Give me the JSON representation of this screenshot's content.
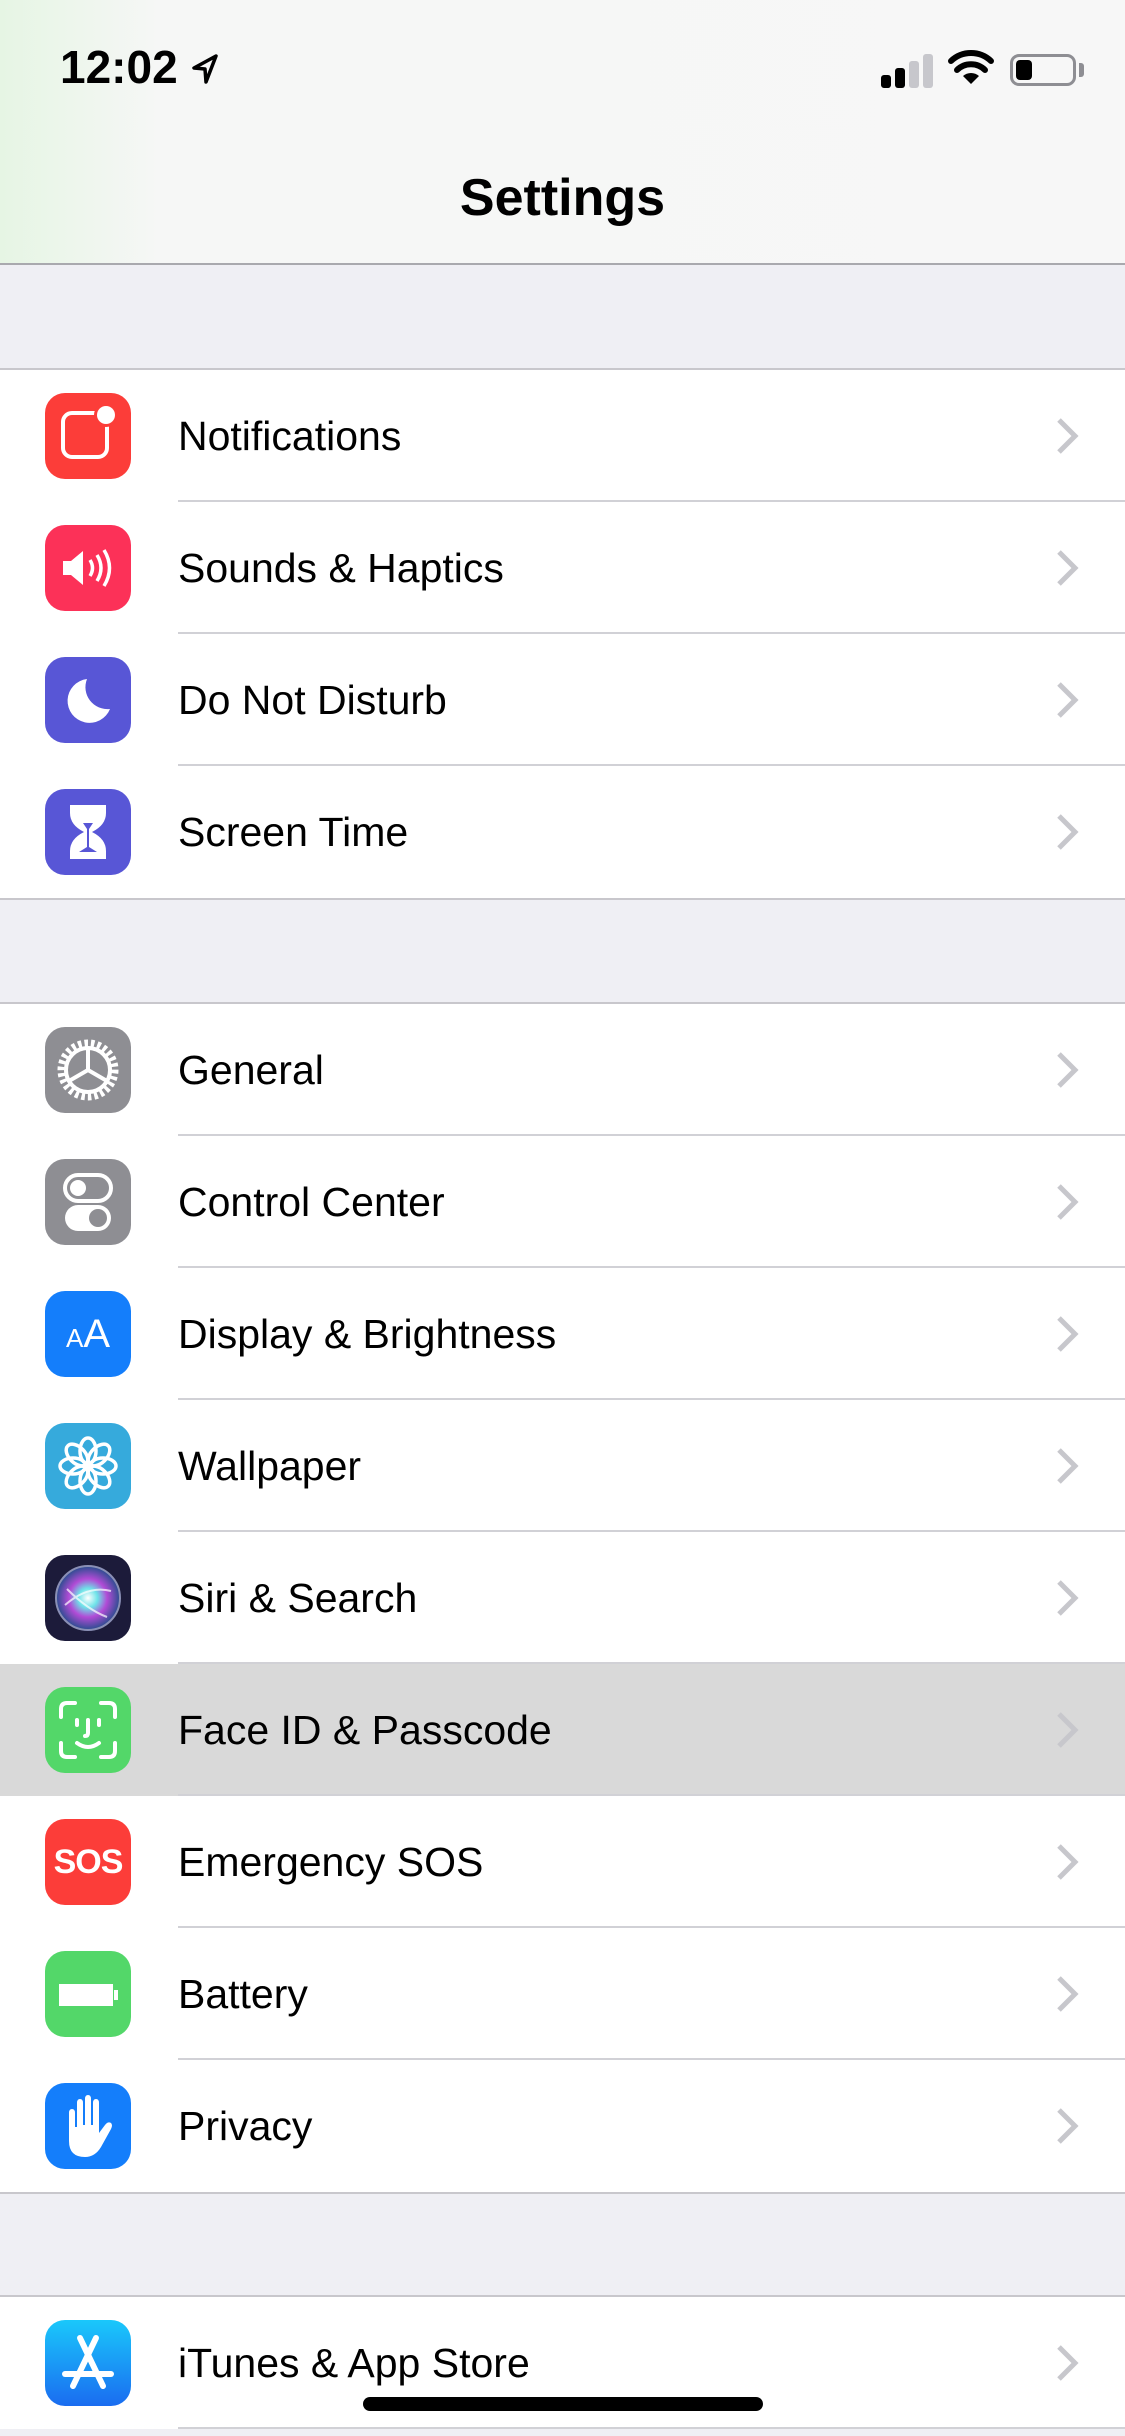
{
  "status_bar": {
    "time": "12:02",
    "location_icon": "location-arrow-icon",
    "signal_bars_active": 2,
    "signal_bars_total": 4,
    "wifi_icon": "wifi-icon",
    "battery_level_percent": 30
  },
  "header": {
    "title": "Settings"
  },
  "colors": {
    "notifications": "#fc3d39",
    "sounds": "#fc3158",
    "dnd": "#5856d6",
    "screen_time": "#5856d6",
    "general": "#8e8e93",
    "control_center": "#8e8e93",
    "display": "#147efb",
    "wallpaper": "#36aadc",
    "siri": "#1c1b3a",
    "face_id": "#53d769",
    "sos": "#fc3d39",
    "battery": "#53d769",
    "privacy": "#147efb",
    "app_store": "#1a8cfb",
    "chevron": "#c7c7cc",
    "highlight_row": "#d9d9d9"
  },
  "sections": [
    {
      "items": [
        {
          "label": "Notifications",
          "icon": "notifications-icon"
        },
        {
          "label": "Sounds & Haptics",
          "icon": "speaker-icon"
        },
        {
          "label": "Do Not Disturb",
          "icon": "moon-icon"
        },
        {
          "label": "Screen Time",
          "icon": "hourglass-icon"
        }
      ]
    },
    {
      "items": [
        {
          "label": "General",
          "icon": "gear-icon"
        },
        {
          "label": "Control Center",
          "icon": "toggles-icon"
        },
        {
          "label": "Display & Brightness",
          "icon": "text-size-icon",
          "icon_text": "AA"
        },
        {
          "label": "Wallpaper",
          "icon": "flower-icon"
        },
        {
          "label": "Siri & Search",
          "icon": "siri-icon"
        },
        {
          "label": "Face ID & Passcode",
          "icon": "face-id-icon",
          "highlighted": true
        },
        {
          "label": "Emergency SOS",
          "icon": "sos-icon",
          "icon_text": "SOS"
        },
        {
          "label": "Battery",
          "icon": "battery-icon"
        },
        {
          "label": "Privacy",
          "icon": "hand-icon"
        }
      ]
    },
    {
      "items": [
        {
          "label": "iTunes & App Store",
          "icon": "app-store-icon"
        }
      ]
    }
  ]
}
